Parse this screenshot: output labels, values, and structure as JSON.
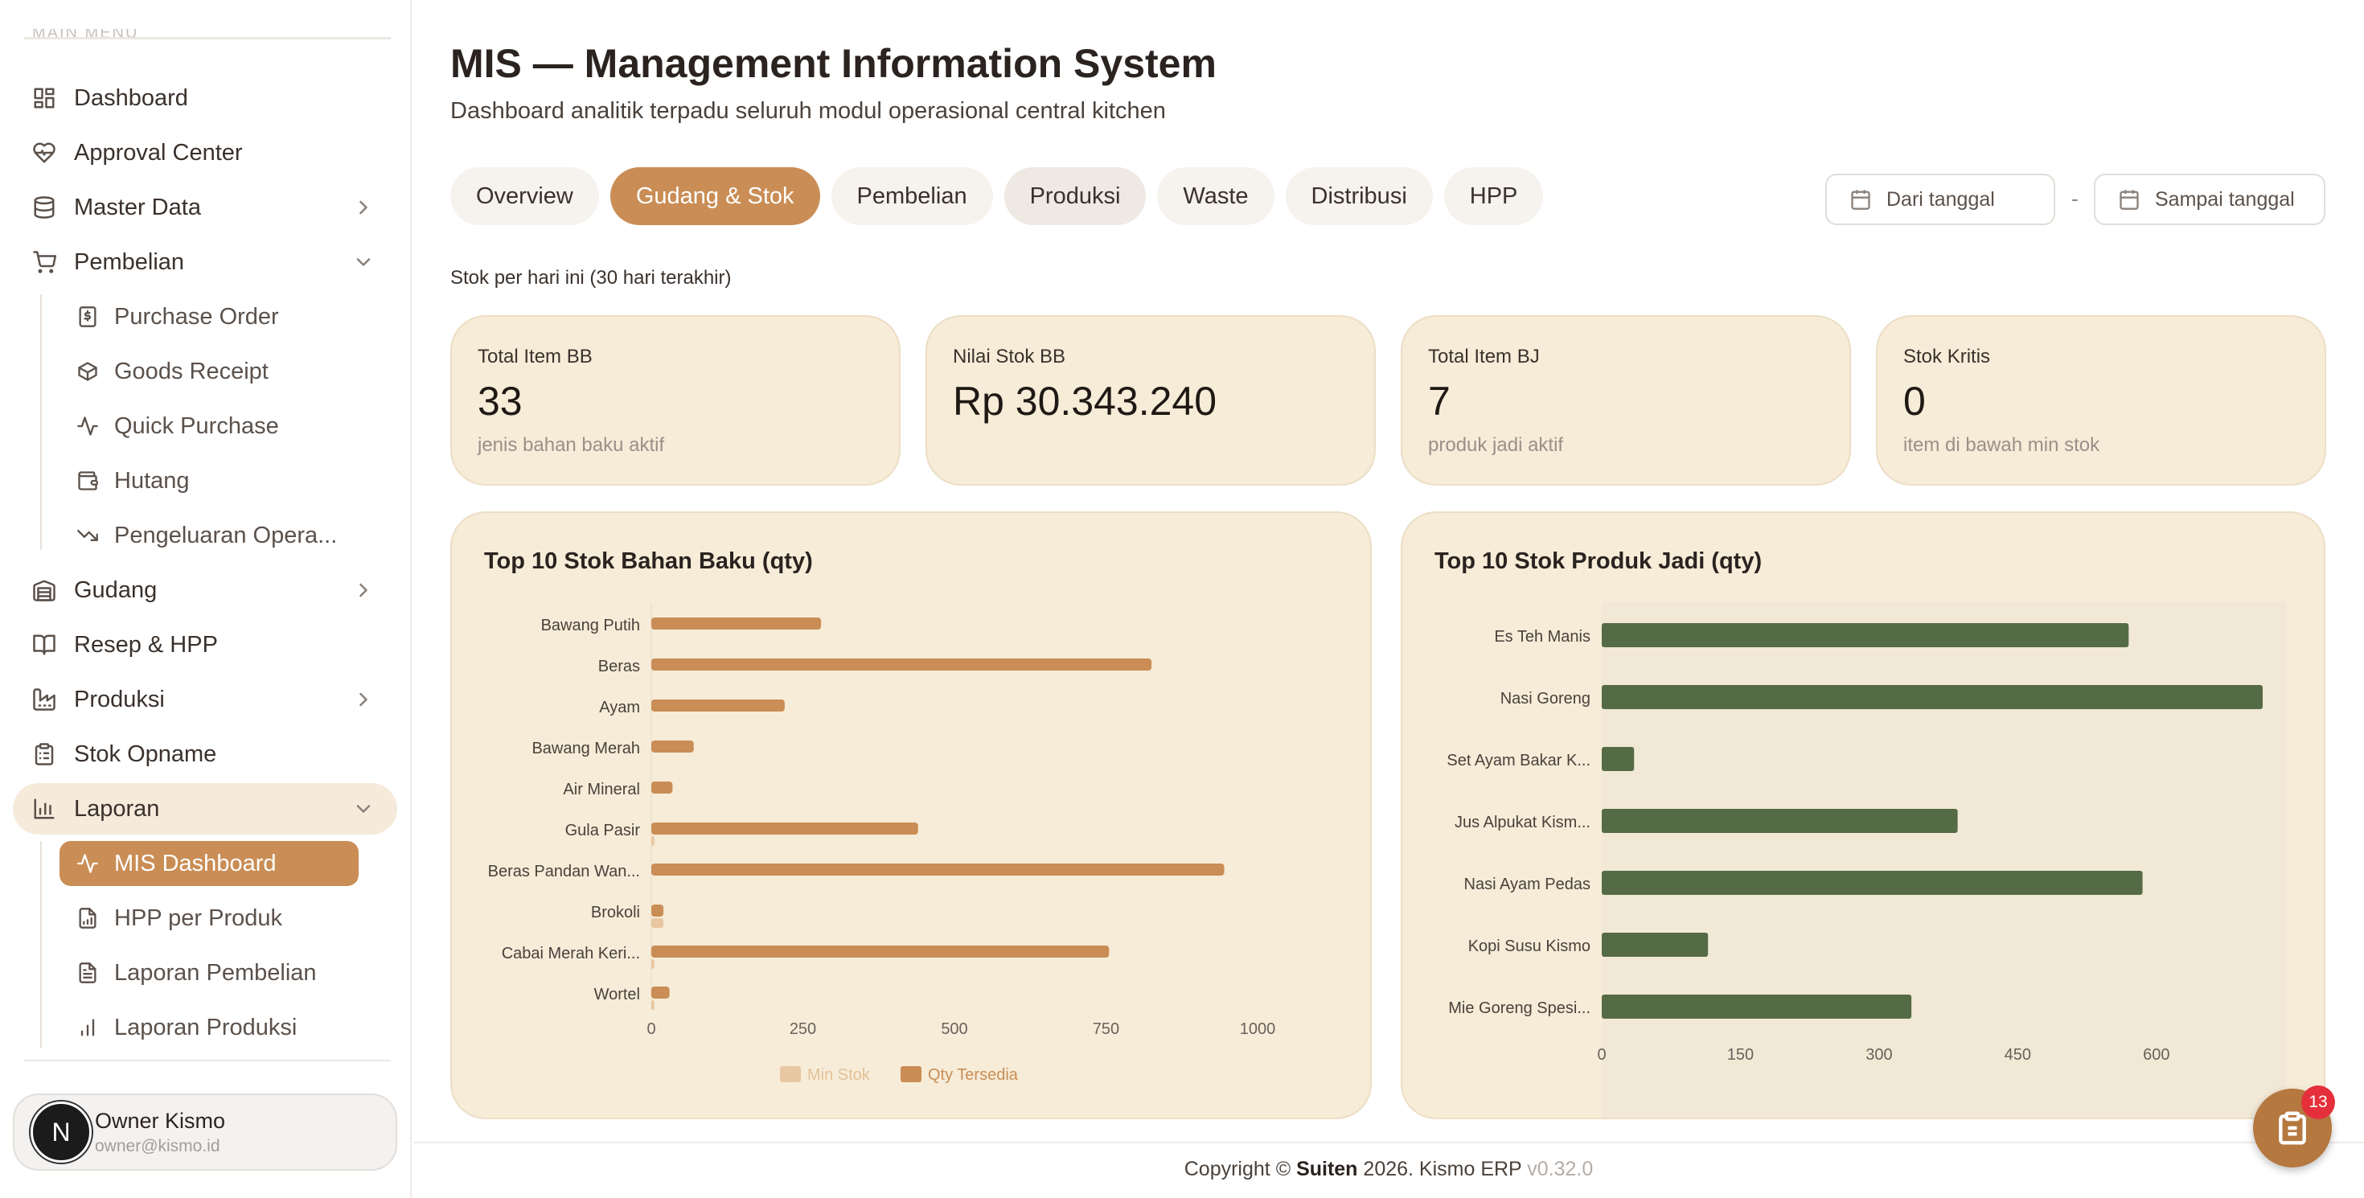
{
  "sidebar": {
    "section_label": "MAIN MENU",
    "items": [
      {
        "label": "Dashboard"
      },
      {
        "label": "Approval Center"
      },
      {
        "label": "Master Data"
      },
      {
        "label": "Pembelian"
      },
      {
        "label": "Gudang"
      },
      {
        "label": "Resep & HPP"
      },
      {
        "label": "Produksi"
      },
      {
        "label": "Stok Opname"
      },
      {
        "label": "Laporan"
      }
    ],
    "pembelian_sub": [
      {
        "label": "Purchase Order"
      },
      {
        "label": "Goods Receipt"
      },
      {
        "label": "Quick Purchase"
      },
      {
        "label": "Hutang"
      },
      {
        "label": "Pengeluaran Opera..."
      }
    ],
    "laporan_sub": [
      {
        "label": "MIS Dashboard"
      },
      {
        "label": "HPP per Produk"
      },
      {
        "label": "Laporan Pembelian"
      },
      {
        "label": "Laporan Produksi"
      }
    ],
    "user": {
      "initial": "N",
      "name": "Owner Kismo",
      "email": "owner@kismo.id"
    }
  },
  "header": {
    "title": "MIS — Management Information System",
    "subtitle": "Dashboard analitik terpadu seluruh modul operasional central kitchen"
  },
  "tabs": [
    {
      "label": "Overview"
    },
    {
      "label": "Gudang & Stok"
    },
    {
      "label": "Pembelian"
    },
    {
      "label": "Produksi"
    },
    {
      "label": "Waste"
    },
    {
      "label": "Distribusi"
    },
    {
      "label": "HPP"
    }
  ],
  "filters": {
    "from_placeholder": "Dari tanggal",
    "separator": "-",
    "to_placeholder": "Sampai tanggal"
  },
  "caption": "Stok per hari ini (30 hari terakhir)",
  "kpis": [
    {
      "label": "Total Item BB",
      "value": "33",
      "hint": "jenis bahan baku aktif"
    },
    {
      "label": "Nilai Stok BB",
      "value": "Rp 30.343.240",
      "hint": ""
    },
    {
      "label": "Total Item BJ",
      "value": "7",
      "hint": "produk jadi aktif"
    },
    {
      "label": "Stok Kritis",
      "value": "0",
      "hint": "item di bawah min stok"
    }
  ],
  "colors": {
    "accent": "#c98d55",
    "min_stok": "#e8c7a2",
    "produk_jadi": "#556b45",
    "card_bg": "#f6ecd8"
  },
  "chart_data": [
    {
      "type": "bar",
      "orientation": "horizontal",
      "title": "Top 10 Stok Bahan Baku (qty)",
      "categories": [
        "Bawang Putih",
        "Beras",
        "Ayam",
        "Bawang Merah",
        "Air Mineral",
        "Gula Pasir",
        "Beras Pandan Wan...",
        "Brokoli",
        "Cabai Merah Keri...",
        "Wortel"
      ],
      "series": [
        {
          "name": "Min Stok",
          "color": "#e8c7a2",
          "values": [
            0,
            0,
            0,
            0,
            0,
            5,
            0,
            20,
            5,
            5
          ]
        },
        {
          "name": "Qty Tersedia",
          "color": "#c98d55",
          "values": [
            280,
            825,
            220,
            70,
            35,
            440,
            945,
            20,
            755,
            30
          ]
        }
      ],
      "xticks": [
        0,
        250,
        500,
        750,
        1000
      ],
      "xlim": [
        0,
        1000
      ],
      "legend": "bottom"
    },
    {
      "type": "bar",
      "orientation": "horizontal",
      "title": "Top 10 Stok Produk Jadi (qty)",
      "categories": [
        "Es Teh Manis",
        "Nasi Goreng",
        "Set Ayam Bakar K...",
        "Jus Alpukat Kism...",
        "Nasi Ayam Pedas",
        "Kopi Susu Kismo",
        "Mie Goreng Spesi..."
      ],
      "series": [
        {
          "values": [
            570,
            715,
            35,
            385,
            585,
            115,
            335
          ]
        }
      ],
      "xticks": [
        0,
        150,
        300,
        450,
        600
      ],
      "xlim": [
        0,
        715
      ]
    }
  ],
  "footer": {
    "prefix": "Copyright © ",
    "brand": "Suiten",
    "middle": " 2026. Kismo ERP ",
    "version": "v0.32.0"
  },
  "fab": {
    "badge": "13",
    "icon": "clipboard-icon"
  }
}
